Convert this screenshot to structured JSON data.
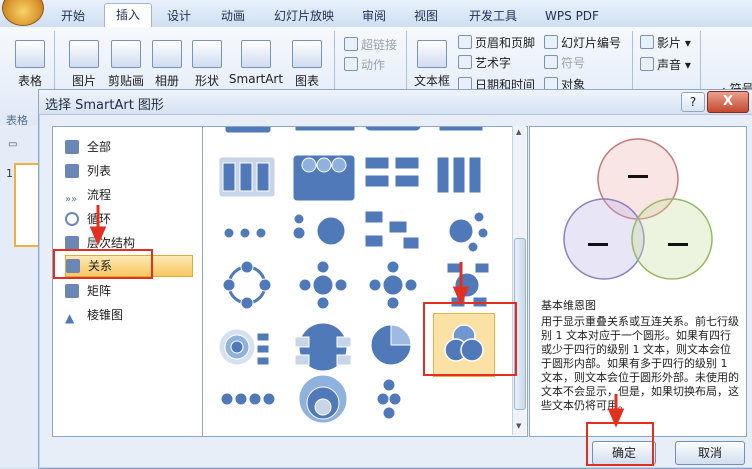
{
  "ribbon": {
    "tabs": [
      "开始",
      "插入",
      "设计",
      "动画",
      "幻灯片放映",
      "审阅",
      "视图",
      "开发工具",
      "WPS PDF"
    ],
    "active_tab": "插入",
    "buttons": [
      "表格",
      "图片",
      "剪贴画",
      "相册",
      "形状",
      "SmartArt",
      "图表",
      "文本框"
    ],
    "small_items": [
      "超链接",
      "动作",
      "页眉和页脚",
      "艺术字",
      "日期和时间",
      "幻灯片编号",
      "符号",
      "对象",
      "影片",
      "声音",
      "符号"
    ],
    "group_label": "表格"
  },
  "slide_pane": {
    "slide_number": "1"
  },
  "dialog": {
    "title": "选择 SmartArt 图形",
    "help": "?",
    "close": "X",
    "categories": [
      "全部",
      "列表",
      "流程",
      "循环",
      "层次结构",
      "关系",
      "矩阵",
      "棱锥图"
    ],
    "selected_category": "关系",
    "preview_title": "基本维恩图",
    "preview_description": "用于显示重叠关系或互连关系。前七行级别 1 文本对应于一个圆形。如果有四行或少于四行的级别 1 文本，则文本会位于圆形内部。如果有多于四行的级别 1 文本，则文本会位于圆形外部。未使用的文本不会显示，但是，如果切换布局，这些文本仍将可用。",
    "ok_label": "确定",
    "cancel_label": "取消"
  },
  "colors": {
    "accent": "#f6c861",
    "highlight": "#e23020",
    "shape_blue": "#4f79b8"
  }
}
